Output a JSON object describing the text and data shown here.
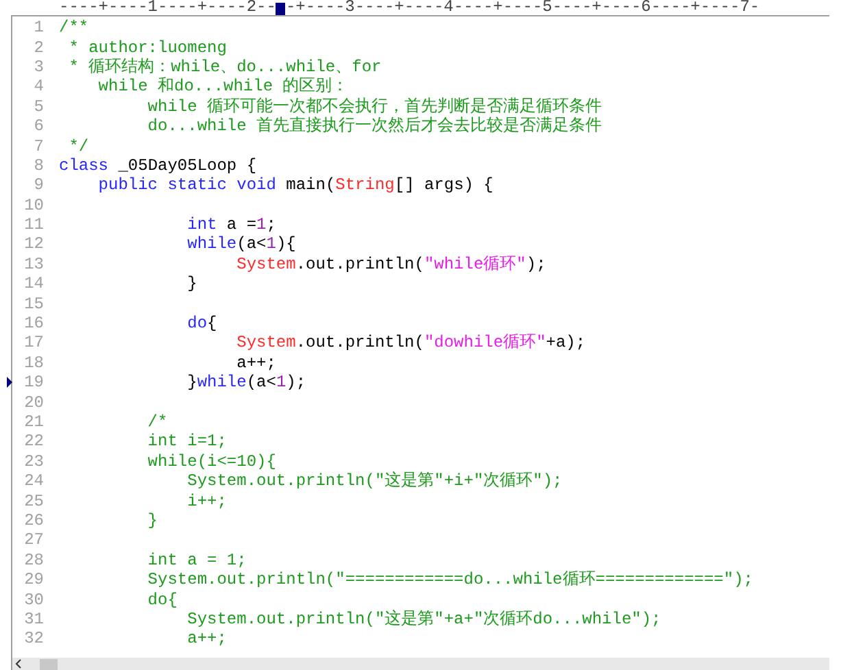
{
  "ruler": {
    "text_before": "----+----1----+----2--",
    "text_after": "-+----3----+----4----+----5----+----6----+----7-"
  },
  "lines": [
    {
      "number": "1",
      "marked": false,
      "tokens": [
        {
          "kind": "comment",
          "text": "/**"
        }
      ]
    },
    {
      "number": "2",
      "marked": false,
      "tokens": [
        {
          "kind": "comment",
          "text": " * author:luomeng"
        }
      ]
    },
    {
      "number": "3",
      "marked": false,
      "tokens": [
        {
          "kind": "comment",
          "text": " * 循环结构：while、do...while、for"
        }
      ]
    },
    {
      "number": "4",
      "marked": false,
      "tokens": [
        {
          "kind": "comment",
          "text": "    while 和do...while 的区别："
        }
      ]
    },
    {
      "number": "5",
      "marked": false,
      "tokens": [
        {
          "kind": "comment",
          "text": "         while 循环可能一次都不会执行，首先判断是否满足循环条件"
        }
      ]
    },
    {
      "number": "6",
      "marked": false,
      "tokens": [
        {
          "kind": "comment",
          "text": "         do...while 首先直接执行一次然后才会去比较是否满足条件"
        }
      ]
    },
    {
      "number": "7",
      "marked": false,
      "tokens": [
        {
          "kind": "comment",
          "text": " */"
        }
      ]
    },
    {
      "number": "8",
      "marked": false,
      "tokens": [
        {
          "kind": "keyword",
          "text": "class"
        },
        {
          "kind": "plain",
          "text": " _05Day05Loop {"
        }
      ]
    },
    {
      "number": "9",
      "marked": false,
      "tokens": [
        {
          "kind": "keyword",
          "text": "    public static void"
        },
        {
          "kind": "plain",
          "text": " main("
        },
        {
          "kind": "type",
          "text": "String"
        },
        {
          "kind": "plain",
          "text": "[] args) {"
        }
      ]
    },
    {
      "number": "10",
      "marked": false
    },
    {
      "number": "11",
      "marked": false,
      "tokens": [
        {
          "kind": "keyword",
          "text": "             int"
        },
        {
          "kind": "plain",
          "text": " a ="
        },
        {
          "kind": "number",
          "text": "1"
        },
        {
          "kind": "plain",
          "text": ";"
        }
      ]
    },
    {
      "number": "12",
      "marked": false,
      "tokens": [
        {
          "kind": "keyword",
          "text": "             while"
        },
        {
          "kind": "plain",
          "text": "(a<"
        },
        {
          "kind": "number",
          "text": "1"
        },
        {
          "kind": "plain",
          "text": "){"
        }
      ]
    },
    {
      "number": "13",
      "marked": false,
      "tokens": [
        {
          "kind": "type",
          "text": "                  System"
        },
        {
          "kind": "plain",
          "text": ".out.println("
        },
        {
          "kind": "string",
          "text": "\"while循环\""
        },
        {
          "kind": "plain",
          "text": ");"
        }
      ]
    },
    {
      "number": "14",
      "marked": false,
      "tokens": [
        {
          "kind": "plain",
          "text": "             }"
        }
      ]
    },
    {
      "number": "15",
      "marked": false
    },
    {
      "number": "16",
      "marked": false,
      "tokens": [
        {
          "kind": "keyword",
          "text": "             do"
        },
        {
          "kind": "plain",
          "text": "{"
        }
      ]
    },
    {
      "number": "17",
      "marked": false,
      "tokens": [
        {
          "kind": "type",
          "text": "                  System"
        },
        {
          "kind": "plain",
          "text": ".out.println("
        },
        {
          "kind": "string",
          "text": "\"dowhile循环\""
        },
        {
          "kind": "plain",
          "text": "+a);"
        }
      ]
    },
    {
      "number": "18",
      "marked": false,
      "tokens": [
        {
          "kind": "plain",
          "text": "                  a++;"
        }
      ]
    },
    {
      "number": "19",
      "marked": true,
      "tokens": [
        {
          "kind": "plain",
          "text": "             }"
        },
        {
          "kind": "keyword",
          "text": "while"
        },
        {
          "kind": "plain",
          "text": "(a<"
        },
        {
          "kind": "number",
          "text": "1"
        },
        {
          "kind": "plain",
          "text": ");"
        }
      ]
    },
    {
      "number": "20",
      "marked": false
    },
    {
      "number": "21",
      "marked": false,
      "tokens": [
        {
          "kind": "comment",
          "text": "         /*"
        }
      ]
    },
    {
      "number": "22",
      "marked": false,
      "tokens": [
        {
          "kind": "comment",
          "text": "         int i=1;"
        }
      ]
    },
    {
      "number": "23",
      "marked": false,
      "tokens": [
        {
          "kind": "comment",
          "text": "         while(i<=10){"
        }
      ]
    },
    {
      "number": "24",
      "marked": false,
      "tokens": [
        {
          "kind": "comment",
          "text": "             System.out.println(\"这是第\"+i+\"次循环\");"
        }
      ]
    },
    {
      "number": "25",
      "marked": false,
      "tokens": [
        {
          "kind": "comment",
          "text": "             i++;"
        }
      ]
    },
    {
      "number": "26",
      "marked": false,
      "tokens": [
        {
          "kind": "comment",
          "text": "         }"
        }
      ]
    },
    {
      "number": "27",
      "marked": false
    },
    {
      "number": "28",
      "marked": false,
      "tokens": [
        {
          "kind": "comment",
          "text": "         int a = 1;"
        }
      ]
    },
    {
      "number": "29",
      "marked": false,
      "tokens": [
        {
          "kind": "comment",
          "text": "         System.out.println(\"============do...while循环=============\");"
        }
      ]
    },
    {
      "number": "30",
      "marked": false,
      "tokens": [
        {
          "kind": "comment",
          "text": "         do{"
        }
      ]
    },
    {
      "number": "31",
      "marked": false,
      "tokens": [
        {
          "kind": "comment",
          "text": "             System.out.println(\"这是第\"+a+\"次循环do...while\");"
        }
      ]
    },
    {
      "number": "32",
      "marked": false,
      "tokens": [
        {
          "kind": "comment",
          "text": "             a++;"
        }
      ]
    }
  ]
}
